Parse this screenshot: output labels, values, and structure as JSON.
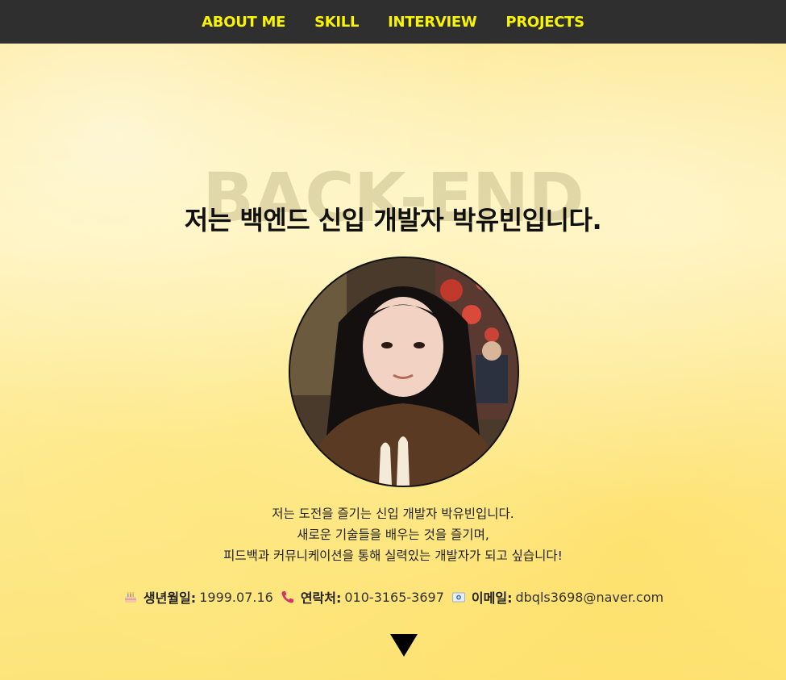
{
  "nav": {
    "items": [
      {
        "label": "ABOUT ME"
      },
      {
        "label": "SKILL"
      },
      {
        "label": "INTERVIEW"
      },
      {
        "label": "PROJECTS"
      }
    ]
  },
  "hero": {
    "background_word": "BACK-END",
    "headline": "저는 백엔드 신입 개발자 박유빈입니다.",
    "intro_lines": [
      "저는 도전을 즐기는 신입 개발자 박유빈입니다.",
      "새로운 기술들을 배우는 것을 즐기며,",
      "피드백과 커뮤니케이션을 통해 실력있는 개발자가 되고 싶습니다!"
    ]
  },
  "info": {
    "birthday": {
      "icon": "birthday-cake-icon",
      "label": "생년월일:",
      "value": "1999.07.16"
    },
    "phone": {
      "icon": "phone-icon",
      "label": "연락처:",
      "value": "010-3165-3697"
    },
    "email": {
      "icon": "email-icon",
      "label": "이메일:",
      "value": "dbqls3698@naver.com"
    }
  },
  "colors": {
    "nav_background": "#2f2f2f",
    "nav_text": "#f9f500",
    "page_background": "#fde98f"
  }
}
